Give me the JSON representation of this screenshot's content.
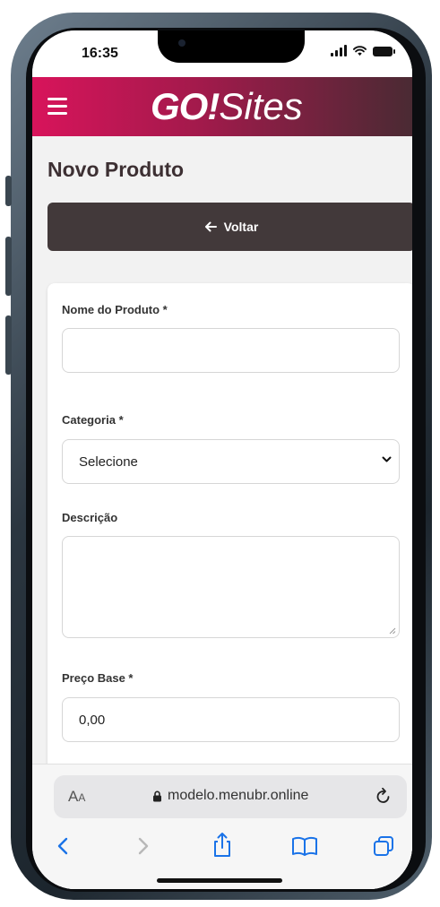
{
  "status_bar": {
    "time": "16:35"
  },
  "header": {
    "logo_go": "GO!",
    "logo_sites": "Sites"
  },
  "page": {
    "title": "Novo Produto"
  },
  "back_button": {
    "label": "Voltar"
  },
  "form": {
    "name_label": "Nome do Produto *",
    "name_value": "",
    "category_label": "Categoria *",
    "category_selected": "Selecione",
    "description_label": "Descrição",
    "description_value": "",
    "price_label": "Preço Base *",
    "price_value": "0,00"
  },
  "browser": {
    "text_size_big": "A",
    "text_size_small": "A",
    "url": "modelo.menubr.online"
  },
  "colors": {
    "header_start": "#d8145b",
    "header_end": "#4a2a33",
    "back_button_bg": "#42393a",
    "title_color": "#3d3033",
    "link_blue": "#1a73e8"
  },
  "icons": [
    "menu-icon",
    "arrow-left-icon",
    "chevron-down-icon",
    "lock-icon",
    "reload-icon",
    "back-icon",
    "forward-icon",
    "share-icon",
    "bookmarks-icon",
    "tabs-icon",
    "signal-icon",
    "wifi-icon",
    "battery-icon"
  ]
}
